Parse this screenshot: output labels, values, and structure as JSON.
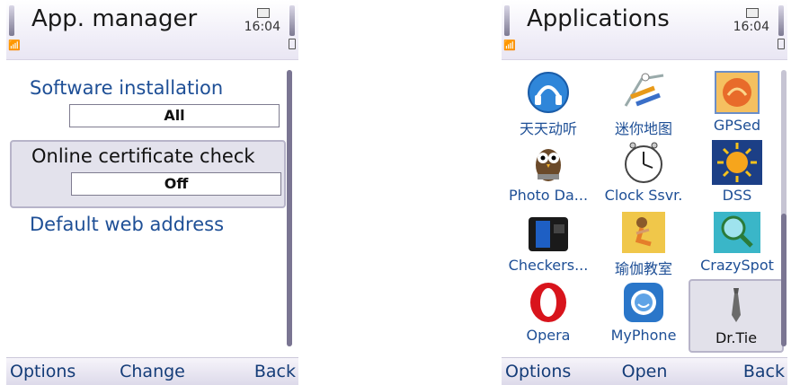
{
  "left_screen": {
    "title": "App. manager",
    "clock": "16:04",
    "settings": [
      {
        "label": "Software installation",
        "value": "All",
        "selected": false
      },
      {
        "label": "Online certificate check",
        "value": "Off",
        "selected": true
      },
      {
        "label": "Default web address",
        "value": null,
        "selected": false
      }
    ],
    "softkeys": {
      "left": "Options",
      "center": "Change",
      "right": "Back"
    }
  },
  "right_screen": {
    "title": "Applications",
    "clock": "16:04",
    "apps": [
      {
        "label": "天天动听",
        "icon": "tiantian-player-icon"
      },
      {
        "label": "迷你地图",
        "icon": "mini-map-icon"
      },
      {
        "label": "GPSed",
        "icon": "gpsed-icon"
      },
      {
        "label": "Photo Da...",
        "icon": "photo-data-owl-icon"
      },
      {
        "label": "Clock Ssvr.",
        "icon": "clock-icon"
      },
      {
        "label": "DSS",
        "icon": "sun-icon"
      },
      {
        "label": "Checkers...",
        "icon": "checkers-icon"
      },
      {
        "label": "瑜伽教室",
        "icon": "yoga-icon"
      },
      {
        "label": "CrazySpot",
        "icon": "crazyspot-icon"
      },
      {
        "label": "Opera",
        "icon": "opera-icon"
      },
      {
        "label": "MyPhone",
        "icon": "myphone-icon"
      },
      {
        "label": "Dr.Tie",
        "icon": "tie-icon",
        "selected": true
      }
    ],
    "softkeys": {
      "left": "Options",
      "center": "Open",
      "right": "Back"
    }
  },
  "colors": {
    "link_blue": "#1e4f96",
    "selection_bg": "#e3e2ec",
    "statusbar_bg": "#ece9f4"
  }
}
